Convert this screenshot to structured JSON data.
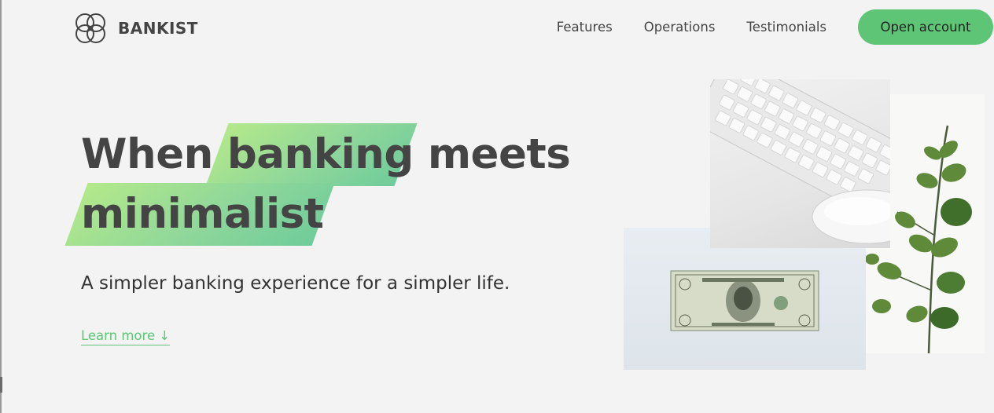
{
  "brand": {
    "name": "BANKIST",
    "accent": "#5ec576"
  },
  "nav": {
    "links": [
      "Features",
      "Operations",
      "Testimonials"
    ],
    "cta": "Open account"
  },
  "hero": {
    "title_line1_before": "When",
    "title_highlight1": "banking",
    "title_line1_after": "meets",
    "title_highlight2": "minimalist",
    "subtitle": "A simpler banking experience for a simpler life.",
    "learn_more": "Learn more ↓"
  },
  "images": [
    "keyboard-and-mouse",
    "dollar-bill",
    "eucalyptus-plant"
  ]
}
